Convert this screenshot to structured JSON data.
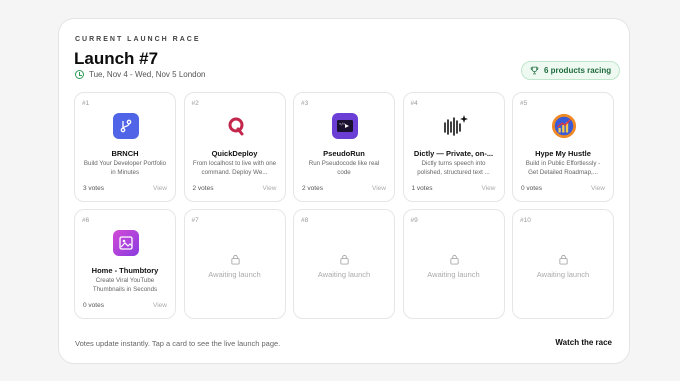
{
  "header": {
    "eyebrow": "CURRENT LAUNCH RACE",
    "title": "Launch #7",
    "dates": "Tue, Nov 4 - Wed, Nov 5 London",
    "racing_badge": "6 products racing"
  },
  "products": [
    {
      "num": "#1",
      "name": "BRNCH",
      "desc": "Build Your Developer Portfolio in Minutes",
      "votes": "3 votes",
      "view": "View",
      "icon": "branch-logo-icon",
      "color": "#4f64e6"
    },
    {
      "num": "#2",
      "name": "QuickDeploy",
      "desc": "From localhost to live with one command. Deploy We...",
      "votes": "2 votes",
      "view": "View",
      "icon": "q-logo-icon",
      "color": "#c2264b"
    },
    {
      "num": "#3",
      "name": "PseudoRun",
      "desc": "Run Pseudocode like real code",
      "votes": "2 votes",
      "view": "View",
      "icon": "pseudorun-logo-icon",
      "color": "#6b3fd6"
    },
    {
      "num": "#4",
      "name": "Dictly — Private, on-...",
      "desc": "Dictly turns speech into polished, structured text ...",
      "votes": "1 votes",
      "view": "View",
      "icon": "waveform-logo-icon",
      "color": "#111111"
    },
    {
      "num": "#5",
      "name": "Hype My Hustle",
      "desc": "Build in Public Effortlessly - Get Detailed Roadmap,...",
      "votes": "0 votes",
      "view": "View",
      "icon": "growth-chart-logo-icon",
      "color": "#f08a24"
    },
    {
      "num": "#6",
      "name": "Home - Thumbtory",
      "desc": "Create Viral YouTube Thumbnails in Seconds",
      "votes": "0 votes",
      "view": "View",
      "icon": "image-logo-icon",
      "color": "#b53bd9"
    }
  ],
  "empty_slots": [
    {
      "num": "#7",
      "label": "Awaiting launch"
    },
    {
      "num": "#8",
      "label": "Awaiting launch"
    },
    {
      "num": "#9",
      "label": "Awaiting launch"
    },
    {
      "num": "#10",
      "label": "Awaiting launch"
    }
  ],
  "footer": {
    "note": "Votes update instantly. Tap a card to see the live launch page.",
    "watch_label": "Watch the race"
  }
}
